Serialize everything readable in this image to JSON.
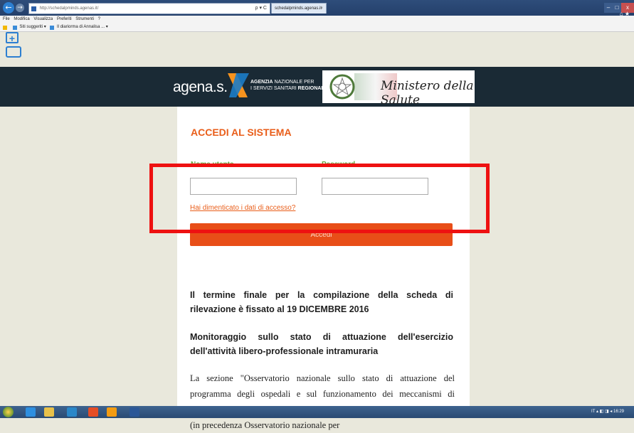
{
  "browser": {
    "url": "http://schedalpminds.agenas.it/",
    "tab_title": "schedalpminds.agenas.it",
    "addr_controls": "ρ ▾ C",
    "tab_close": "×",
    "window_controls": {
      "minimize": "–",
      "maximize": "□",
      "close": "x"
    },
    "right_icons": "⌂ ★",
    "menu": [
      "File",
      "Modifica",
      "Visualizza",
      "Preferiti",
      "Strumenti",
      "?"
    ],
    "favorites": [
      {
        "label": "Siti suggeriti ▾"
      },
      {
        "label": "Il diariorma di Annalisa ... ▾"
      }
    ]
  },
  "header": {
    "brand": "agena.s.",
    "brand_sub_line1_bold": "AGENZIA",
    "brand_sub_line1": " NAZIONALE PER",
    "brand_sub_line2": "I SERVIZI SANITARI ",
    "brand_sub_line2_bold": "REGIONALI",
    "ministry": "Ministero della Salute"
  },
  "login": {
    "title": "ACCEDI AL SISTEMA",
    "username_label": "Nome utente",
    "password_label": "Password",
    "forgot_link": "Hai dimenticato i dati di accesso?",
    "submit_label": "Accedi"
  },
  "content": {
    "notice": "Il termine finale per la compilazione della scheda di rilevazione è fissato al 19 DICEMBRE 2016",
    "section_title": "Monitoraggio sullo stato di attuazione dell'esercizio dell'attività libero-professionale intramuraria",
    "paragraph": "La sezione \"Osservatorio nazionale sullo stato di attuazione del programma degli ospedali e sul funzionamento dei meccanismi di controllo a livello regionale e aziendale\" del Comitato tecnico sanitario (in precedenza Osservatorio nazionale per"
  },
  "taskbar": {
    "tray_lang": "IT",
    "clock_time": "16:29"
  },
  "colors": {
    "accent": "#e84e18",
    "label_green": "#67a33c",
    "header_bg": "#1a2a35",
    "highlight": "#ee1111"
  }
}
